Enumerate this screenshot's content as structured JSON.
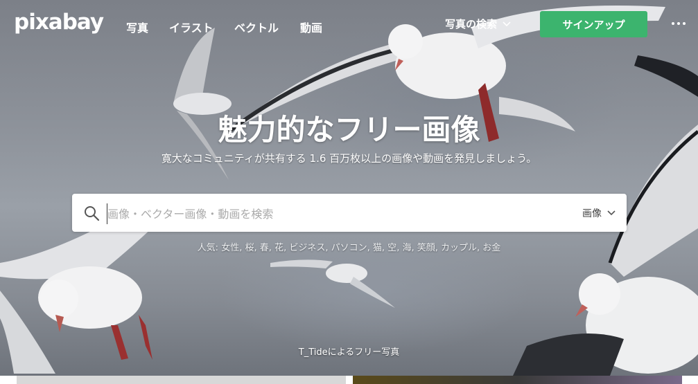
{
  "nav": {
    "logo": "pixabay",
    "links": [
      "写真",
      "イラスト",
      "ベクトル",
      "動画"
    ],
    "search_type": "写真の検索",
    "signup": "サインアップ"
  },
  "hero": {
    "headline": "魅力的なフリー画像",
    "subtitle": "寛大なコミュニティが共有する 1.6 百万枚以上の画像や動画を発見しましょう。",
    "credit": "T_Tideによるフリー写真"
  },
  "search": {
    "placeholder": "画像・ベクター画像・動画を検索",
    "value": "",
    "filter": "画像"
  },
  "popular": {
    "label": "人気:",
    "tags": [
      "女性",
      "桜",
      "春",
      "花",
      "ビジネス",
      "パソコン",
      "猫",
      "空",
      "海",
      "笑顔",
      "カップル",
      "お金"
    ]
  },
  "colors": {
    "accent": "#3cb46e",
    "sky": "#8e939b"
  },
  "icons": {
    "search": "search-icon",
    "chevron": "chevron-down-icon",
    "more": "more-icon"
  }
}
